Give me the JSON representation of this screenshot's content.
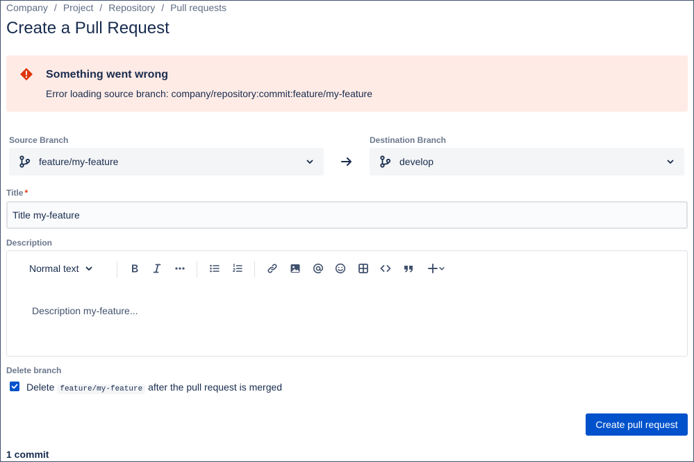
{
  "breadcrumb": [
    "Company",
    "Project",
    "Repository",
    "Pull requests"
  ],
  "page_title": "Create a Pull Request",
  "error": {
    "title": "Something went wrong",
    "message": "Error loading source branch: company/repository:commit:feature/my-feature",
    "icon": "warning-icon",
    "color": "#de350b"
  },
  "source_branch": {
    "label": "Source Branch",
    "value": "feature/my-feature",
    "icon": "branch-icon"
  },
  "destination_branch": {
    "label": "Destination Branch",
    "value": "develop",
    "icon": "branch-icon"
  },
  "title_field": {
    "label": "Title",
    "required_mark": "*",
    "value": "Title my-feature"
  },
  "description": {
    "label": "Description",
    "text_style": "Normal text",
    "placeholder": "Description my-feature..."
  },
  "delete_branch": {
    "label": "Delete branch",
    "checked": true,
    "text_before": "Delete",
    "branch_code": "feature/my-feature",
    "text_after": "after the pull request is merged"
  },
  "create_button": "Create pull request",
  "commit_count": "1 commit",
  "colors": {
    "primary": "#0052cc",
    "error_bg": "#ffebe6",
    "text": "#172b4d"
  }
}
